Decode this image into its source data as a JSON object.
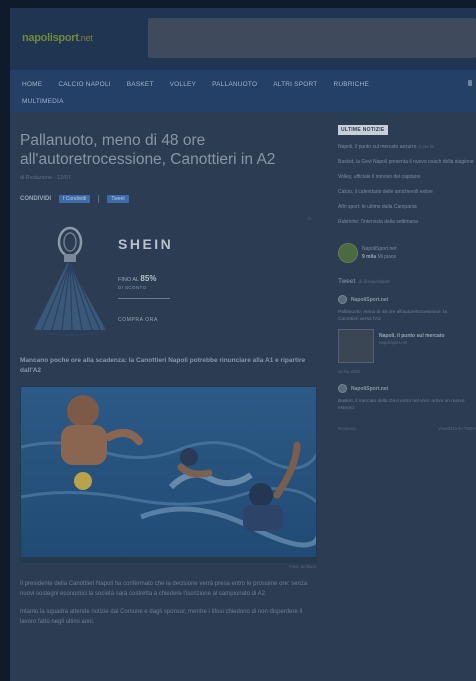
{
  "header": {
    "logo": "napolisport",
    "logo_tld": ".net"
  },
  "nav": {
    "row1": [
      "HOME",
      "CALCIO NAPOLI",
      "BASKET",
      "VOLLEY",
      "PALLANUOTO",
      "ALTRI SPORT",
      "RUBRICHE"
    ],
    "row2": [
      "MULTIMEDIA"
    ]
  },
  "article": {
    "title": "Pallanuoto, meno di 48 ore all'autoretrocessione, Canottieri in A2",
    "byline": "di Redazione - 12/07",
    "share_label": "CONDIVIDI",
    "share_facebook": "f Condividi",
    "share_twitter": "Tweet",
    "lead": "Mancano poche ore alla scadenza: la Canottieri Napoli potrebbe rinunciare alla A1 e ripartire dall'A2",
    "photo_caption": "Foto: archivio",
    "paragraphs": [
      "Il presidente della Canottieri Napoli ha confermato che la decisione verrà presa entro le prossime ore: senza nuovi sostegni economici la società sarà costretta a chiedere l'iscrizione al campionato di A2.",
      "Intanto la squadra attende notizie dal Comune e dagli sponsor, mentre i tifosi chiedono di non disperdere il lavoro fatto negli ultimi anni."
    ]
  },
  "ad": {
    "brand": "SHEIN",
    "discount_prefix": "FINO AL ",
    "discount_value": "85%",
    "sub": "DI SCONTO",
    "cta": "COMPRA ORA"
  },
  "sidebar": {
    "latest_header": "ULTIME NOTIZIE",
    "latest": [
      {
        "text": "Napoli, il punto sul mercato azzurro",
        "time": "2 ore fa"
      },
      {
        "text": "Basket, la Gevi Napoli presenta il nuovo coach della stagione",
        "time": ""
      },
      {
        "text": "Volley, ufficiale il rinnovo del capitano",
        "time": ""
      },
      {
        "text": "Calcio, il calendario delle amichevoli estive",
        "time": ""
      },
      {
        "text": "Altri sport: le ultime dalla Campania",
        "time": ""
      },
      {
        "text": "Rubriche: l'intervista della settimana",
        "time": ""
      }
    ],
    "page_name": "NapoliSport.net",
    "page_likes": "9 mila",
    "page_likes_label": "Mi piace",
    "tweets_title": "Tweet",
    "tweets_by": "di @napolisport",
    "tweets": [
      {
        "user": "NapoliSport.net",
        "text": "Pallanuoto, meno di 48 ore all'autoretrocessione: la Canottieri verso l'A2"
      },
      {
        "user": "NapoliSport.net",
        "text": "Basket, il mercato della Gevi entra nel vivo: arriva un nuovo esterno"
      }
    ],
    "tweet_card_title": "Napoli, il punto sul mercato",
    "tweet_card_sub": "napolisport.net",
    "tweet_time": "12 lug 2023",
    "embed_label": "Incorpora",
    "view_on": "Visualizza su Twitter"
  }
}
